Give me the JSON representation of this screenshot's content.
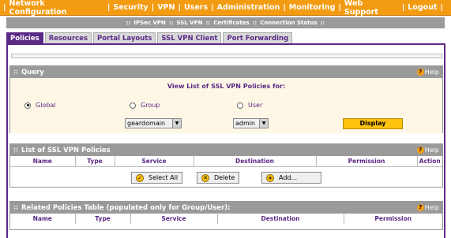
{
  "top_nav": [
    "Network Configuration",
    "Security",
    "VPN",
    "Users",
    "Administration",
    "Monitoring",
    "Web Support",
    "Logout"
  ],
  "sub_nav": [
    "IPSec VPN",
    "SSL VPN",
    "Certificates",
    "Connection Status"
  ],
  "tabs": [
    "Policies",
    "Resources",
    "Portal Layouts",
    "SSL VPN Client",
    "Port Forwarding"
  ],
  "help_label": "Help",
  "query": {
    "title": "Query",
    "subtitle": "View List of SSL VPN Policies for:",
    "radio_global": "Global",
    "radio_group": "Group",
    "radio_user": "User",
    "selected": "Global",
    "group_select_value": "geardomain",
    "user_select_value": "admin",
    "display_button": "Display"
  },
  "list": {
    "title": "List of SSL VPN Policies",
    "columns": [
      "Name",
      "Type",
      "Service",
      "Destination",
      "Permission",
      "Action"
    ],
    "select_all_button": "Select All",
    "delete_button": "Delete",
    "add_button": "Add..."
  },
  "related": {
    "title": "Related Policies Table (populated only for Group/User):",
    "columns": [
      "Name",
      "Type",
      "Service",
      "Destination",
      "Permission"
    ]
  },
  "colors": {
    "nav_orange": "#f39c12",
    "accent_purple": "#5b2a85",
    "button_yellow": "#ffc20e",
    "header_gray": "#9a9a9a"
  }
}
